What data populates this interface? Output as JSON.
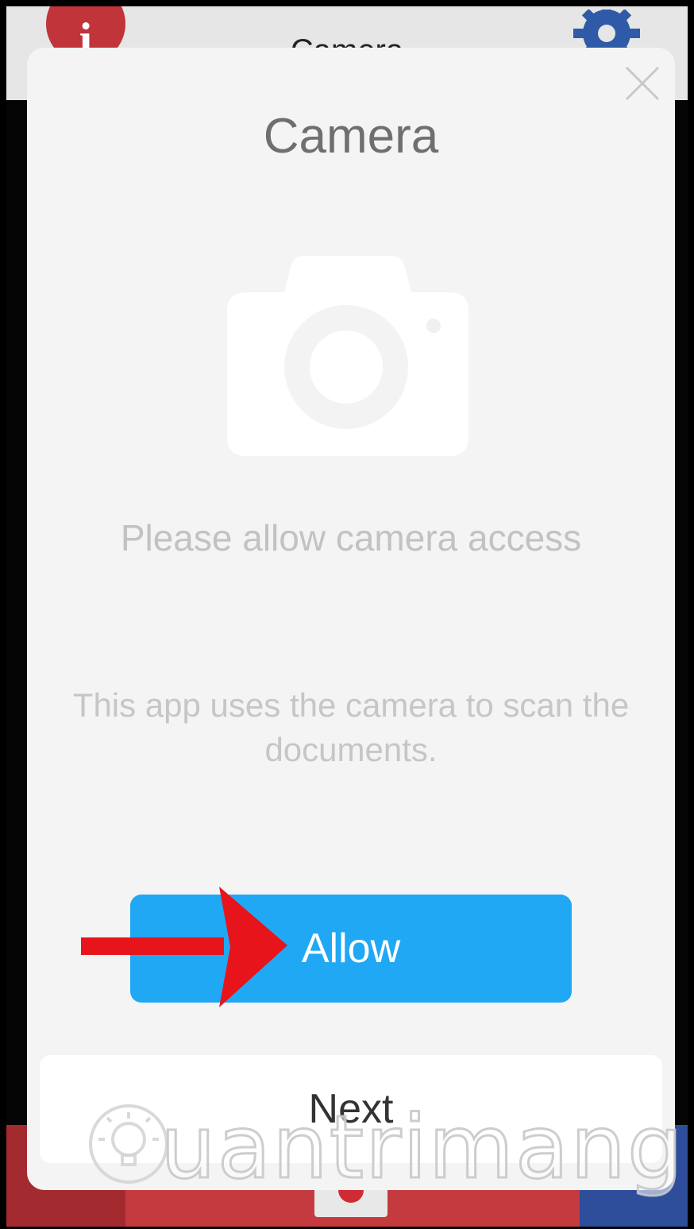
{
  "app": {
    "header_title": "Camera",
    "header_info_glyph": "i",
    "header_right_icon": "gear-icon",
    "footer_left_icon": "bulb-icon",
    "footer_center_icon": "camera-shutter-icon",
    "footer_right_icon": "share-icon",
    "colors": {
      "header_bg": "#e6e6e6",
      "info_red": "#c0343a",
      "gear_blue": "#2f5aa8",
      "footer_red": "#c53a3f",
      "footer_blue": "#2e4e9c"
    }
  },
  "dialog": {
    "title": "Camera",
    "close_icon": "close-icon",
    "illustration": "camera-icon",
    "prompt": "Please allow camera access",
    "description": "This app uses the camera to scan the documents.",
    "allow_label": "Allow",
    "next_label": "Next",
    "colors": {
      "dialog_bg": "#f4f4f4",
      "allow_bg": "#21a8f5",
      "allow_text": "#ffffff",
      "annotation_arrow": "#e8141c"
    }
  },
  "watermark": {
    "text": "uantrimang",
    "icon": "bulb-icon"
  }
}
